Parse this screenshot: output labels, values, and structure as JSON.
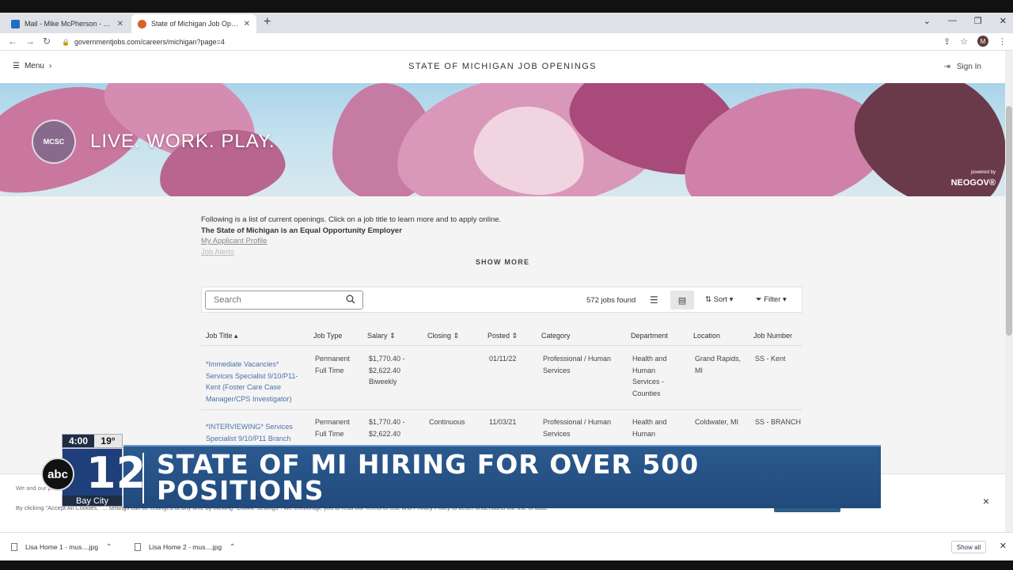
{
  "browser": {
    "tabs": [
      {
        "label": "Mail - Mike McPherson - Outlook",
        "favicon_color": "#1d6fc4"
      },
      {
        "label": "State of Michigan Job Openings",
        "favicon_color": "#d9622b"
      }
    ],
    "new_tab": "+",
    "url": "governmentjobs.com/careers/michigan?page=4",
    "avatar_initial": "M"
  },
  "site": {
    "menu_label": "Menu",
    "title": "STATE OF MICHIGAN JOB OPENINGS",
    "signin_label": "Sign In"
  },
  "banner": {
    "seal_text": "MCSC",
    "tagline": "LIVE. WORK. PLAY.",
    "powered_by": "powered by",
    "neogov": "NEOGOV®"
  },
  "intro": {
    "line1": "Following is a list of current openings. Click on a job title to learn more and to apply online.",
    "line2": "The State of Michigan is an Equal Opportunity Employer",
    "link1": "My Applicant Profile",
    "link2": "Job Alerts",
    "show_more": "SHOW MORE"
  },
  "toolbar": {
    "search_placeholder": "Search",
    "jobs_found": "572 jobs found",
    "sort_label": "Sort ▾",
    "filter_label": "Filter ▾"
  },
  "table": {
    "headers": [
      "Job Title ▴",
      "Job Type",
      "Salary ⇕",
      "Closing ⇕",
      "Posted ⇕",
      "Category",
      "Department",
      "Location",
      "Job Number"
    ],
    "rows": [
      {
        "title": "*Immediate Vacancies* Services Specialist 9/10/P11-Kent (Foster Care Case Manager/CPS Investigator)",
        "type": "Permanent Full Time",
        "salary": "$1,770.40 - $2,622.40 Biweekly",
        "closing": "",
        "posted": "01/11/22",
        "category": "Professional / Human Services",
        "department": "Health and Human Services - Counties",
        "location": "Grand Rapids, MI",
        "number": "SS - Kent"
      },
      {
        "title": "*INTERVIEWING* Services Specialist 9/10/P11 Branch",
        "type": "Permanent Full Time",
        "salary": "$1,770.40 - $2,622.40",
        "closing": "Continuous",
        "posted": "11/03/21",
        "category": "Professional / Human Services",
        "department": "Health and Human",
        "location": "Coldwater, MI",
        "number": "SS - BRANCH"
      }
    ]
  },
  "cookie": {
    "text1": "We and our pa",
    "text2": "By clicking \"Accept All Cookies,\" ... settings can be changed at any time by clicking \"Cookie Settings\". We encourage you to read our Terms of Use and Privacy Policy to better understand our use of data.",
    "close": "×"
  },
  "downloads": {
    "items": [
      "Lisa Home 1 - mus....jpg",
      "Lisa Home 2 - mus....jpg"
    ],
    "show_all": "Show all"
  },
  "overlay": {
    "time": "4:00",
    "temp": "19°",
    "channel": "12",
    "network": "abc",
    "city": "Bay City",
    "headline": "STATE OF MI HIRING FOR OVER 500 POSITIONS"
  }
}
